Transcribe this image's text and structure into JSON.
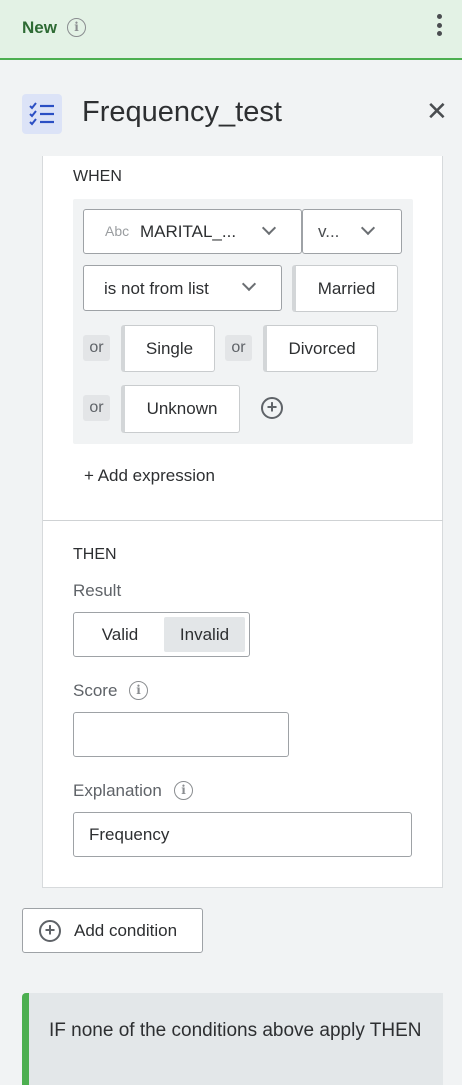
{
  "topbar": {
    "status": "New",
    "info_icon": "info-icon",
    "menu_icon": "more-vert-icon",
    "accent": "#4caf50"
  },
  "header": {
    "title": "Frequency_test",
    "icon": "checklist-icon",
    "close_icon": "close-icon"
  },
  "condition": {
    "when_label": "WHEN",
    "attribute": {
      "type_badge": "Abc",
      "value": "MARITAL_...",
      "icon": "chevron-down-icon"
    },
    "field_select": {
      "value": "v..."
    },
    "operator": {
      "value": "is not from list"
    },
    "values": [
      "Married",
      "Single",
      "Divorced",
      "Unknown"
    ],
    "or_label": "or",
    "add_value_icon": "add-circle-icon",
    "add_expression": "+ Add expression",
    "then_label": "THEN",
    "result_label": "Result",
    "result_options": [
      "Valid",
      "Invalid"
    ],
    "result_selected": "Invalid",
    "score_label": "Score",
    "score_value": "",
    "explanation_label": "Explanation",
    "explanation_value": "Frequency"
  },
  "add_condition": {
    "label": "Add condition",
    "icon": "add-circle-icon"
  },
  "fallback": {
    "text": "IF none of the conditions above apply THEN"
  }
}
